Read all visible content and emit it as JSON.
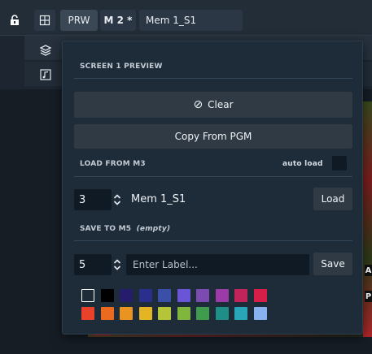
{
  "topbar": {
    "prw_label": "PRW",
    "m2_label": "M 2 *",
    "memory_name": "Mem 1_S1"
  },
  "overlay_labels": {
    "a": "A",
    "p": "P"
  },
  "panel": {
    "preview_title": "SCREEN 1 PREVIEW",
    "clear_icon": "⊘",
    "clear_label": "Clear",
    "copy_label": "Copy From PGM",
    "load_title": "LOAD FROM M3",
    "auto_load_label": "auto load",
    "load_number": "3",
    "load_memory_name": "Mem 1_S1",
    "load_button": "Load",
    "save_title": "SAVE TO M5",
    "save_note": "(empty)",
    "save_number": "5",
    "save_placeholder": "Enter Label...",
    "save_button": "Save"
  },
  "colors": {
    "row1": [
      "#ffffff",
      "#000000",
      "#251d6b",
      "#2a2f8e",
      "#3a4fa8",
      "#6a55d6",
      "#7c4bb2",
      "#9c3aa8",
      "#c0245a",
      "#d61f48"
    ],
    "row2": [
      "#e8422a",
      "#ea6a1f",
      "#e99320",
      "#e4b422",
      "#b6c43a",
      "#7fb63b",
      "#3f9c4c",
      "#1e8e86",
      "#2aa6b9",
      "#8ab1ef"
    ]
  }
}
